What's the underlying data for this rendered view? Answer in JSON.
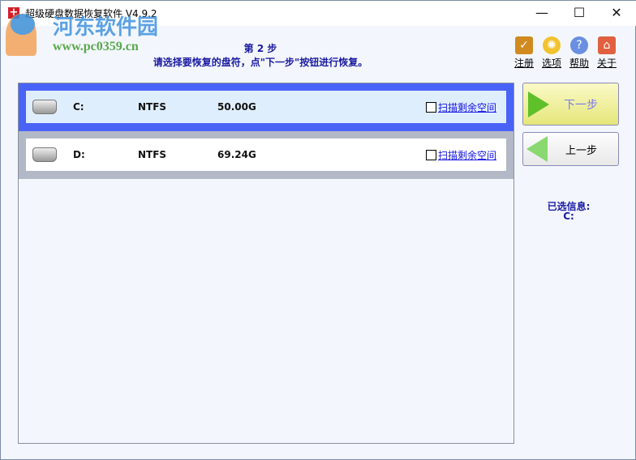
{
  "window": {
    "title": "超级硬盘数据恢复软件 V4.9.2",
    "minimize": "—",
    "maximize": "☐",
    "close": "✕"
  },
  "watermark": {
    "name": "河东软件园",
    "url": "www.pc0359.cn"
  },
  "header": {
    "step": "第 2 步",
    "instruction": "请选择要恢复的盘符，点\"下一步\"按钮进行恢复。"
  },
  "toolbar": [
    {
      "label": "注册",
      "icon": "cart-icon"
    },
    {
      "label": "选项",
      "icon": "gear-icon"
    },
    {
      "label": "帮助",
      "icon": "help-icon"
    },
    {
      "label": "关于",
      "icon": "home-icon"
    }
  ],
  "drives": [
    {
      "letter": "C:",
      "fs": "NTFS",
      "size": "50.00G",
      "scan_label": "扫描剩余空间",
      "selected": true
    },
    {
      "letter": "D:",
      "fs": "NTFS",
      "size": "69.24G",
      "scan_label": "扫描剩余空间",
      "selected": false
    }
  ],
  "buttons": {
    "next": "下一步",
    "prev": "上一步"
  },
  "info": {
    "label": "已选信息:",
    "value": "C:"
  },
  "colors": {
    "selected_band": "#4a63f7",
    "unselected_band": "#b3b8c6",
    "accent_text": "#1a1aa0"
  }
}
